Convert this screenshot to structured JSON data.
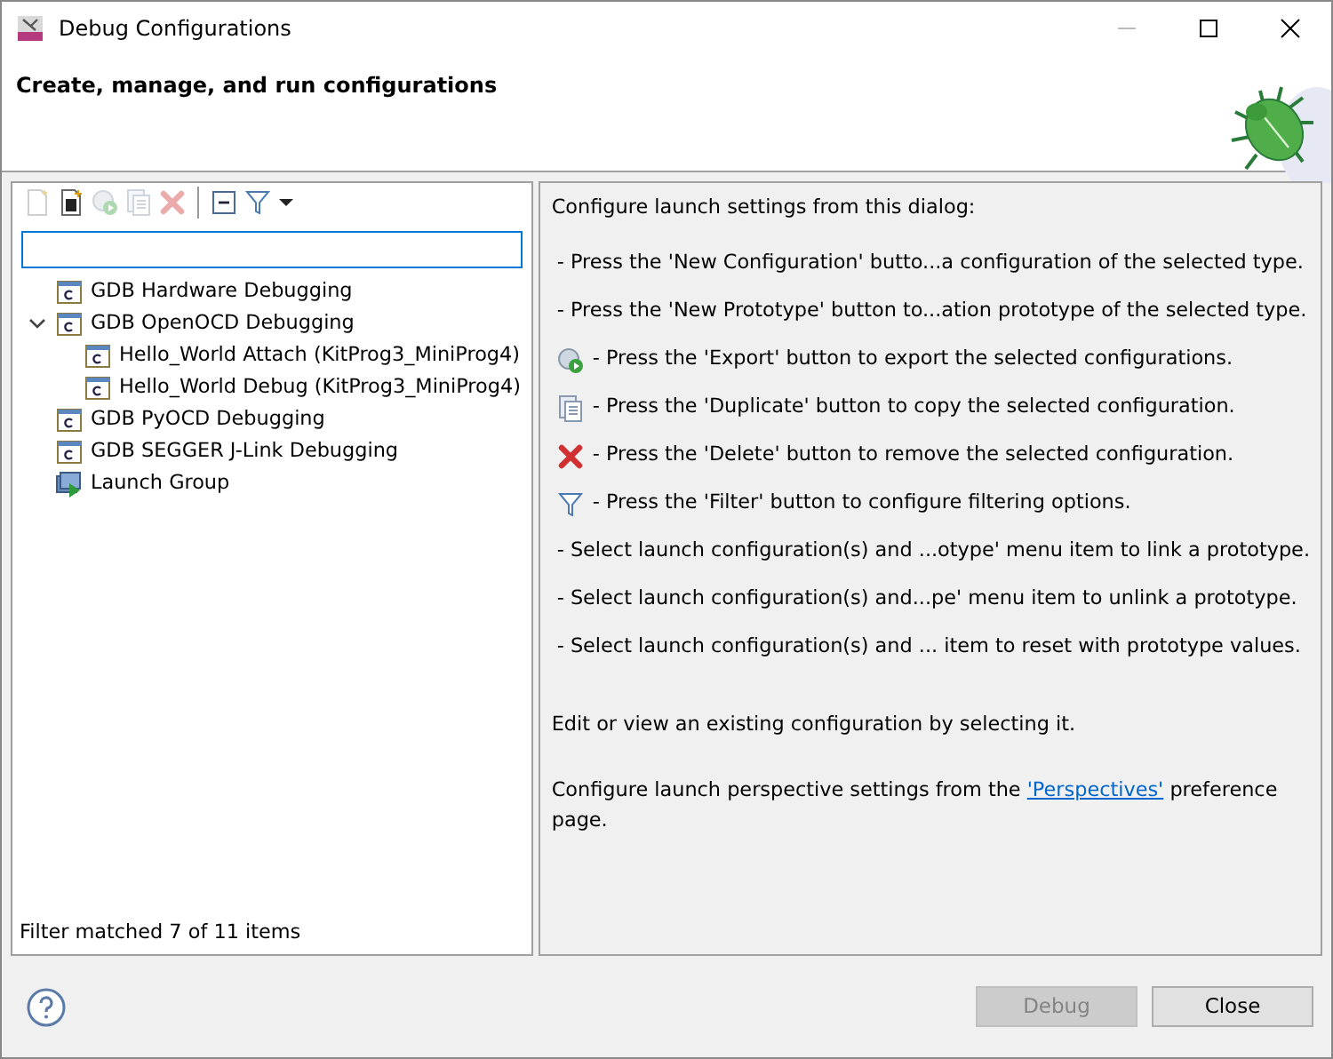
{
  "window": {
    "title": "Debug Configurations"
  },
  "header": {
    "title": "Create, manage, and run configurations"
  },
  "toolbar": [
    {
      "kind": "new",
      "disabled": true
    },
    {
      "kind": "prototype",
      "disabled": false
    },
    {
      "kind": "export",
      "disabled": true
    },
    {
      "kind": "duplicate",
      "disabled": true
    },
    {
      "kind": "delete",
      "disabled": true
    },
    {
      "kind": "separator"
    },
    {
      "kind": "collapse",
      "disabled": false
    },
    {
      "kind": "filter",
      "disabled": false
    },
    {
      "kind": "dropdown",
      "disabled": false
    }
  ],
  "tree": [
    {
      "label": "GDB Hardware Debugging",
      "kind": "config"
    },
    {
      "label": "GDB OpenOCD Debugging",
      "kind": "config",
      "expanded": true,
      "children": [
        {
          "label": "Hello_World Attach (KitProg3_MiniProg4)",
          "kind": "config"
        },
        {
          "label": "Hello_World Debug (KitProg3_MiniProg4)",
          "kind": "config"
        }
      ]
    },
    {
      "label": "GDB PyOCD Debugging",
      "kind": "config"
    },
    {
      "label": "GDB SEGGER J-Link Debugging",
      "kind": "config"
    },
    {
      "label": "Launch Group",
      "kind": "group"
    }
  ],
  "filter_status": "Filter matched 7 of 11 items",
  "help": {
    "intro": "Configure launch settings from this dialog:",
    "lines": [
      {
        "kind": "plain",
        "text": "- Press the 'New Configuration' butto...a configuration of the selected type."
      },
      {
        "kind": "plain",
        "text": "- Press the 'New Prototype' button to...ation prototype of the selected type."
      },
      {
        "kind": "export",
        "text": "- Press the 'Export' button to export the selected configurations."
      },
      {
        "kind": "duplicate",
        "text": "- Press the 'Duplicate' button to copy the selected configuration."
      },
      {
        "kind": "delete",
        "text": "- Press the 'Delete' button to remove the selected configuration."
      },
      {
        "kind": "filter",
        "text": "- Press the 'Filter' button to configure filtering options."
      },
      {
        "kind": "plain",
        "text": "- Select launch configuration(s) and ...otype' menu item to link a prototype."
      },
      {
        "kind": "plain",
        "text": "- Select launch configuration(s) and...pe' menu item to unlink a prototype."
      },
      {
        "kind": "plain",
        "text": "- Select launch configuration(s) and ... item to reset with prototype values."
      }
    ],
    "edit_note": "Edit or view an existing configuration by selecting it.",
    "perspective_before": "Configure launch perspective settings from the",
    "perspective_link": "'Perspectives'",
    "perspective_after": "preference page."
  },
  "buttons": [
    {
      "label": "Debug",
      "disabled": true
    },
    {
      "label": "Close",
      "disabled": false
    }
  ]
}
